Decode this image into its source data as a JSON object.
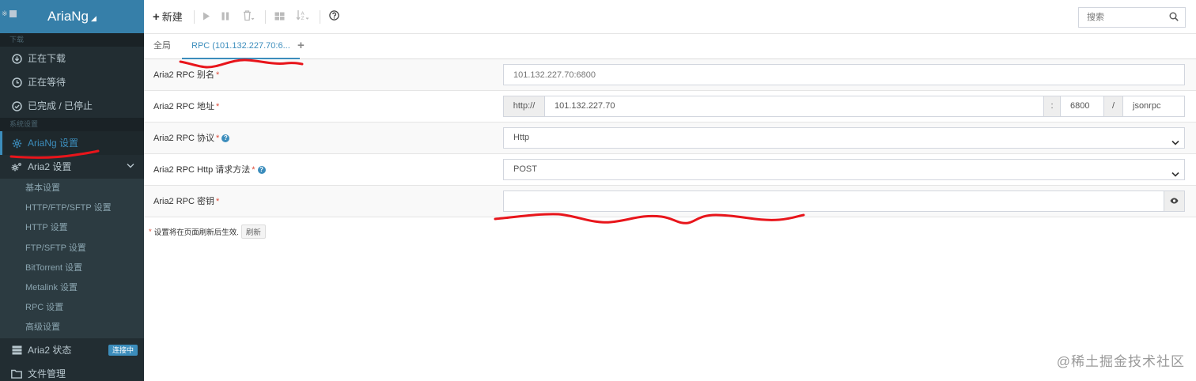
{
  "sidebar": {
    "logo_corner_text": "※",
    "brand": "AriaNg",
    "section_download": "下载",
    "downloading": "正在下载",
    "waiting": "正在等待",
    "finished": "已完成 / 已停止",
    "section_settings": "系统设置",
    "ariang_settings": "AriaNg 设置",
    "aria2_settings": "Aria2 设置",
    "sub_items": [
      "基本设置",
      "HTTP/FTP/SFTP 设置",
      "HTTP 设置",
      "FTP/SFTP 设置",
      "BitTorrent 设置",
      "Metalink 设置",
      "RPC 设置",
      "高级设置"
    ],
    "aria2_status": "Aria2 状态",
    "status_badge": "连接中",
    "file_manager": "文件管理"
  },
  "toolbar": {
    "new_label": "新建",
    "search_placeholder": "搜索"
  },
  "tabs": {
    "global": "全局",
    "rpc": "RPC (101.132.227.70:6...",
    "add": "+"
  },
  "form": {
    "alias_label": "Aria2 RPC 别名",
    "alias_placeholder": "101.132.227.70:6800",
    "address_label": "Aria2 RPC 地址",
    "address_scheme": "http://",
    "address_host": "101.132.227.70",
    "address_colon": ":",
    "address_port": "6800",
    "address_slash": "/",
    "address_path": "jsonrpc",
    "protocol_label": "Aria2 RPC 协议",
    "protocol_value": "Http",
    "method_label": "Aria2 RPC Http 请求方法",
    "method_value": "POST",
    "secret_label": "Aria2 RPC 密钥",
    "secret_value": "",
    "required_mark": "*",
    "note_text": "设置将在页面刷新后生效.",
    "refresh_button": "刷新"
  },
  "watermark": "@稀土掘金技术社区",
  "colors": {
    "sidebar_bg": "#222d32",
    "logo_bg": "#367fa9",
    "accent": "#3c8dbc",
    "required": "#dd4b39",
    "annotation": "#e8151b"
  }
}
